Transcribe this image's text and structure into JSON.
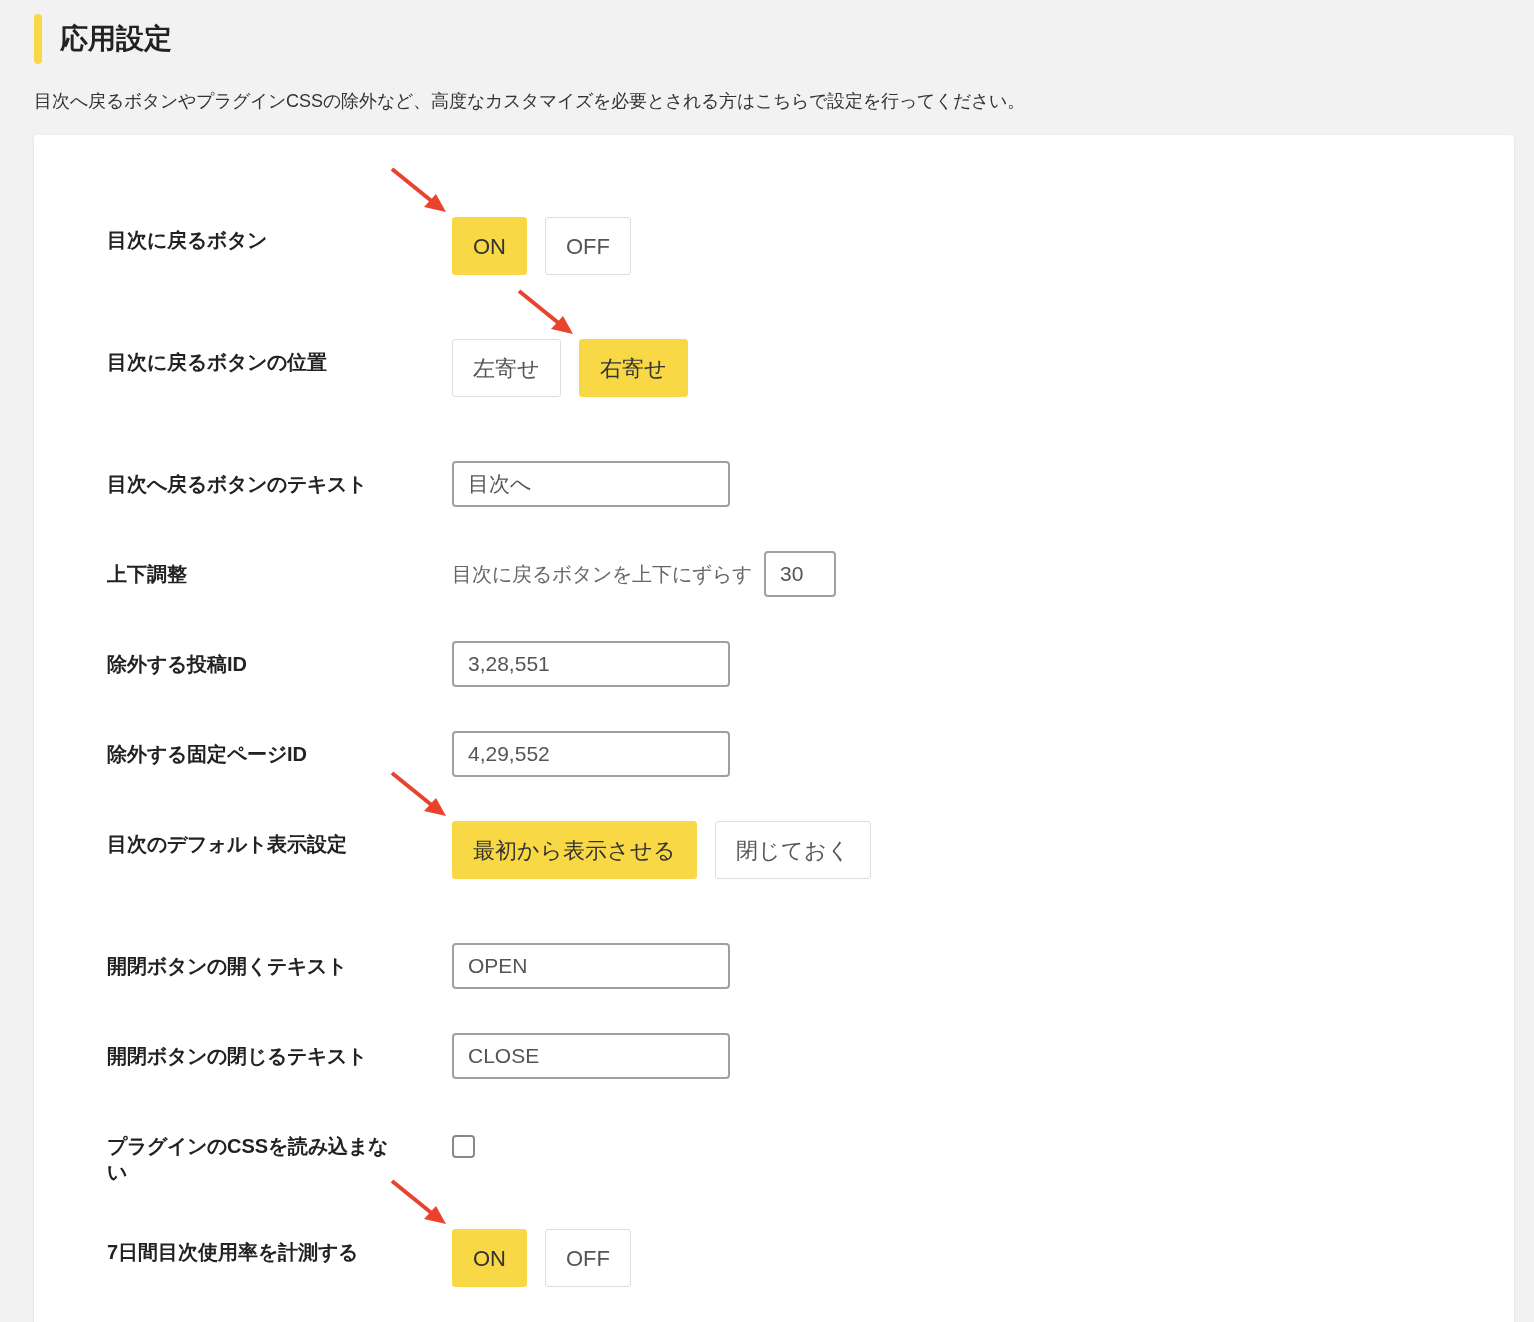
{
  "section": {
    "title": "応用設定",
    "description": "目次へ戻るボタンやプラグインCSSの除外など、高度なカスタマイズを必要とされる方はこちらで設定を行ってください。"
  },
  "settings": [
    {
      "kind": "toggle",
      "label": "目次に戻るボタン",
      "options": [
        {
          "label": "ON",
          "selected": true,
          "pointed": true
        },
        {
          "label": "OFF",
          "selected": false,
          "pointed": false
        }
      ]
    },
    {
      "kind": "toggle",
      "label": "目次に戻るボタンの位置",
      "options": [
        {
          "label": "左寄せ",
          "selected": false,
          "pointed": false
        },
        {
          "label": "右寄せ",
          "selected": true,
          "pointed": true
        }
      ]
    },
    {
      "kind": "text",
      "label": "目次へ戻るボタンのテキスト",
      "value": "目次へ"
    },
    {
      "kind": "inline",
      "label": "上下調整",
      "prefix": "目次に戻るボタンを上下にずらす",
      "value": "30"
    },
    {
      "kind": "text",
      "label": "除外する投稿ID",
      "value": "3,28,551"
    },
    {
      "kind": "text",
      "label": "除外する固定ページID",
      "value": "4,29,552"
    },
    {
      "kind": "toggle",
      "label": "目次のデフォルト表示設定",
      "options": [
        {
          "label": "最初から表示させる",
          "selected": true,
          "pointed": true
        },
        {
          "label": "閉じておく",
          "selected": false,
          "pointed": false
        }
      ]
    },
    {
      "kind": "text",
      "label": "開閉ボタンの開くテキスト",
      "value": "OPEN"
    },
    {
      "kind": "text",
      "label": "開閉ボタンの閉じるテキスト",
      "value": "CLOSE"
    },
    {
      "kind": "checkbox",
      "label": "プラグインのCSSを読み込まない",
      "checked": false
    },
    {
      "kind": "toggle",
      "label": "7日間目次使用率を計測する",
      "options": [
        {
          "label": "ON",
          "selected": true,
          "pointed": true
        },
        {
          "label": "OFF",
          "selected": false,
          "pointed": false
        }
      ]
    }
  ]
}
